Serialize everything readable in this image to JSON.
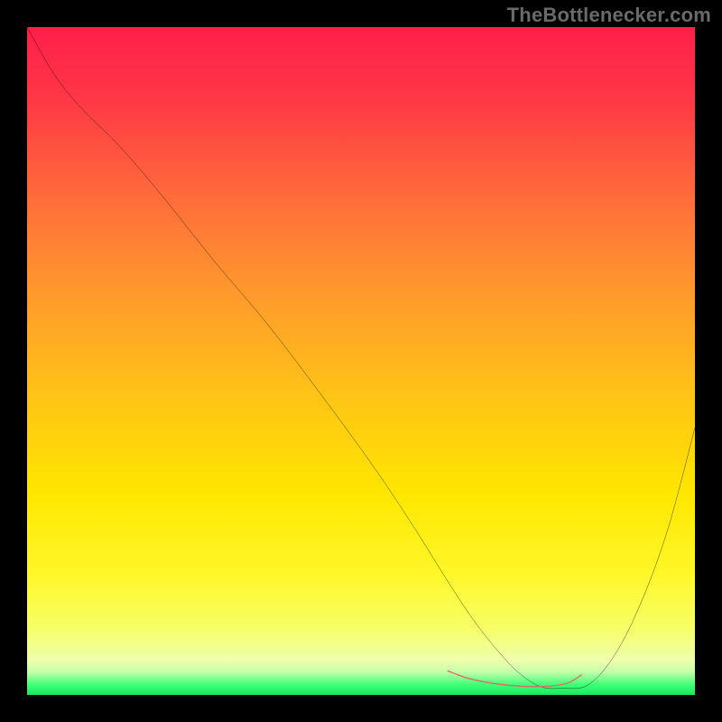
{
  "watermark": {
    "text": "TheBottlenecker.com"
  },
  "gradient": {
    "stops": [
      {
        "offset": 0.0,
        "color": "#ff1f4a"
      },
      {
        "offset": 0.1,
        "color": "#ff3546"
      },
      {
        "offset": 0.25,
        "color": "#ff6a3b"
      },
      {
        "offset": 0.4,
        "color": "#ff9a2c"
      },
      {
        "offset": 0.55,
        "color": "#ffc316"
      },
      {
        "offset": 0.7,
        "color": "#ffe700"
      },
      {
        "offset": 0.82,
        "color": "#fff72a"
      },
      {
        "offset": 0.9,
        "color": "#f6ff66"
      },
      {
        "offset": 0.948,
        "color": "#efffad"
      },
      {
        "offset": 0.965,
        "color": "#c8ffab"
      },
      {
        "offset": 0.985,
        "color": "#3dff76"
      },
      {
        "offset": 1.0,
        "color": "#18e85e"
      }
    ]
  },
  "chart_data": {
    "type": "line",
    "title": "",
    "xlabel": "",
    "ylabel": "",
    "xlim": [
      0,
      100
    ],
    "ylim": [
      0,
      100
    ],
    "series": [
      {
        "name": "bottleneck-curve",
        "color": "#000000",
        "x": [
          0,
          4,
          8,
          14,
          20,
          28,
          36,
          44,
          52,
          58,
          63,
          67,
          71,
          74,
          77,
          80,
          84,
          88,
          92,
          96,
          100
        ],
        "y": [
          100,
          93,
          88,
          82,
          75,
          65,
          55.5,
          45,
          34,
          25,
          17,
          11,
          6,
          3,
          1.2,
          1.0,
          1.5,
          6,
          14,
          25,
          40
        ]
      },
      {
        "name": "optimal-band-marker",
        "color": "#e06666",
        "x": [
          63,
          66,
          70,
          74,
          78,
          81,
          83
        ],
        "y": [
          3.6,
          2.5,
          1.7,
          1.3,
          1.3,
          1.8,
          3.0
        ]
      }
    ],
    "annotations": []
  }
}
